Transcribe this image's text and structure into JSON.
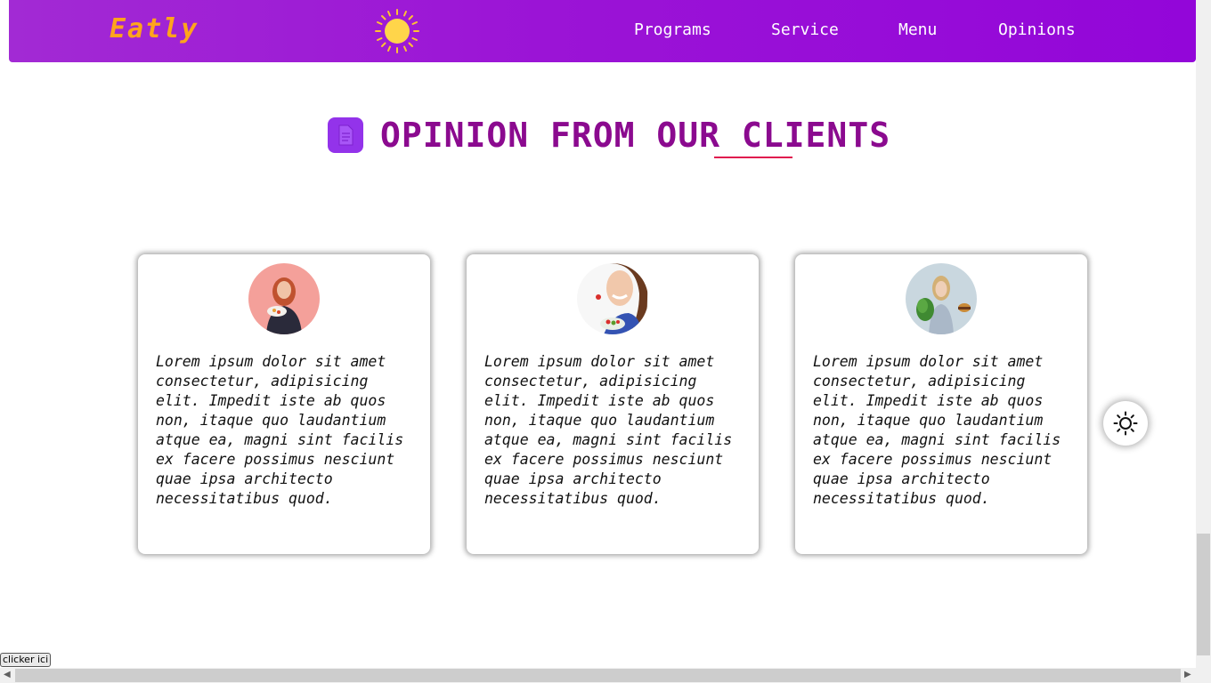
{
  "nav": {
    "logo": "Eatly",
    "links": [
      "Programs",
      "Service",
      "Menu",
      "Opinions"
    ]
  },
  "section": {
    "title": "OPINION FROM OUR CLIENTS"
  },
  "cards": [
    {
      "text": "Lorem ipsum dolor sit amet consectetur, adipisicing elit. Impedit iste ab quos non, itaque quo laudantium atque ea, magni sint facilis ex facere possimus nesciunt quae ipsa architecto necessitatibus quod."
    },
    {
      "text": "Lorem ipsum dolor sit amet consectetur, adipisicing elit. Impedit iste ab quos non, itaque quo laudantium atque ea, magni sint facilis ex facere possimus nesciunt quae ipsa architecto necessitatibus quod."
    },
    {
      "text": "Lorem ipsum dolor sit amet consectetur, adipisicing elit. Impedit iste ab quos non, itaque quo laudantium atque ea, magni sint facilis ex facere possimus nesciunt quae ipsa architecto necessitatibus quod."
    }
  ],
  "clicker_label": "clicker ici",
  "colors": {
    "nav_bg": "#9b14d6",
    "logo": "#ffa41c",
    "title": "#8b0a8f",
    "underline": "#e01a4f"
  },
  "icons": {
    "sun_logo": "sun-icon",
    "heading": "document-icon",
    "theme_toggle": "sun-outline-icon"
  }
}
